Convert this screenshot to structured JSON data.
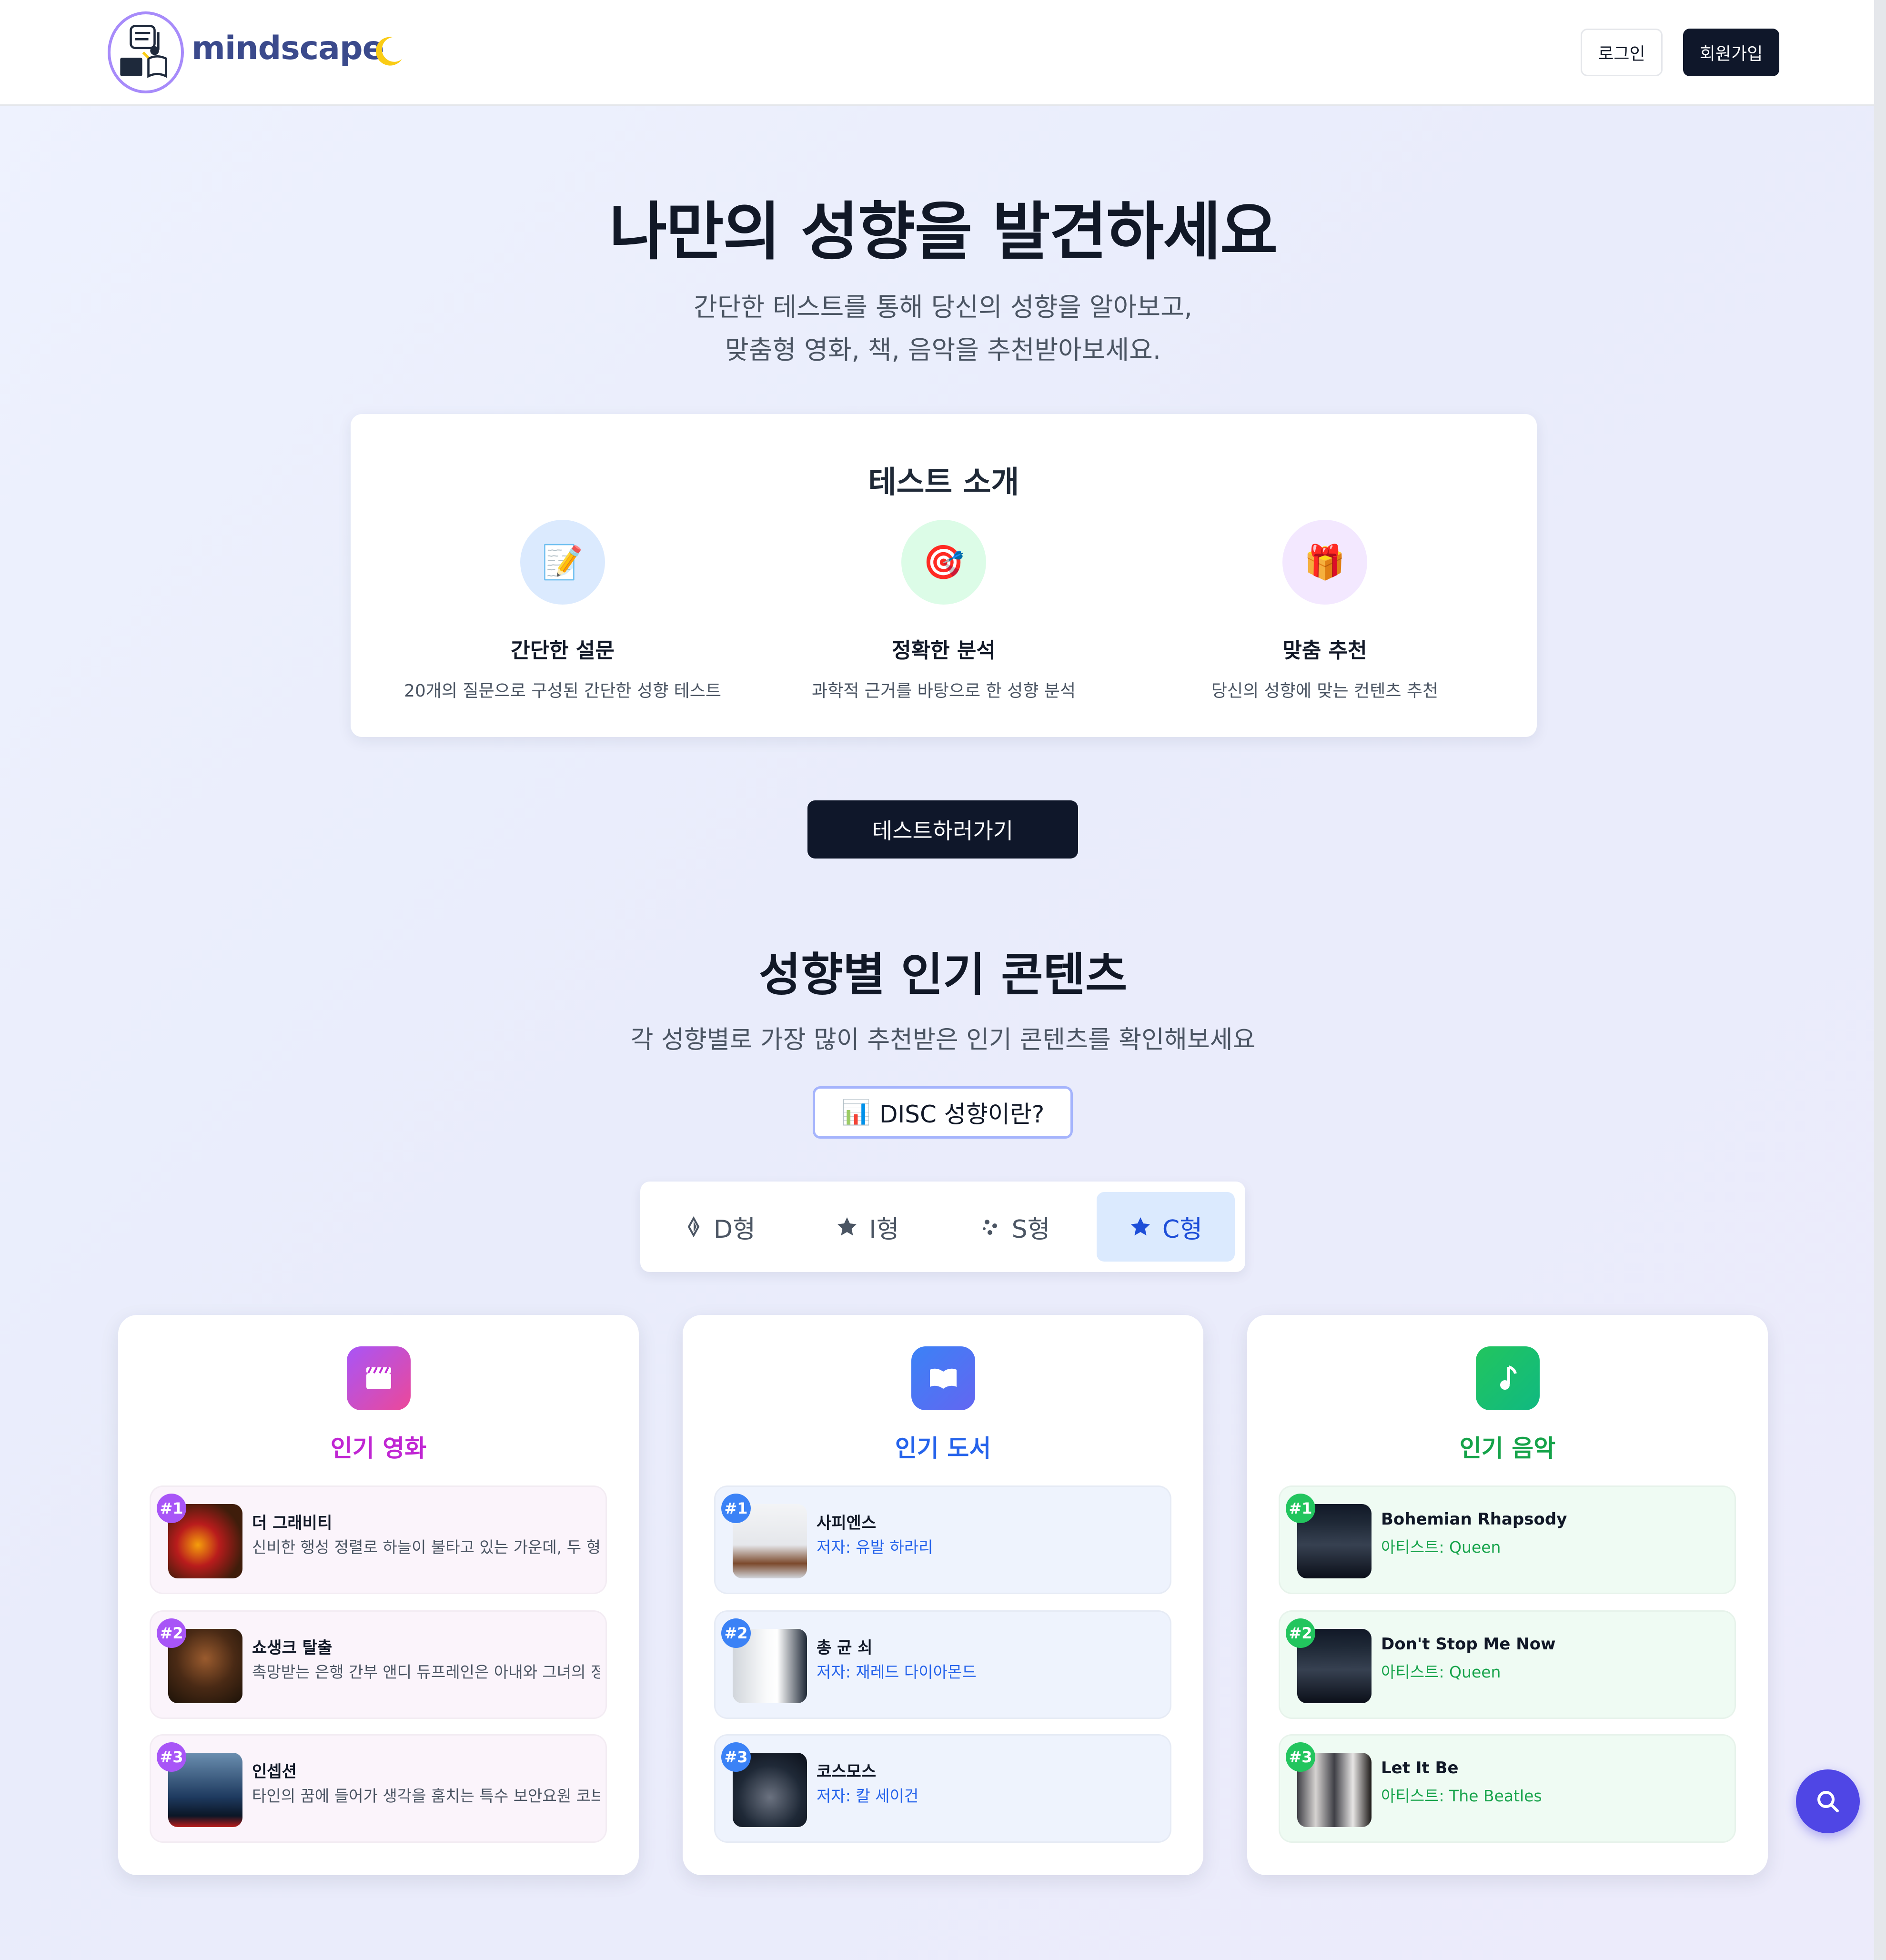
{
  "header": {
    "brand": "mindscape",
    "login_label": "로그인",
    "signup_label": "회원가입"
  },
  "hero": {
    "title": "나만의 성향을 발견하세요",
    "subtitle_line1": "간단한 테스트를 통해 당신의 성향을 알아보고,",
    "subtitle_line2": "맞춤형 영화, 책, 음악을 추천받아보세요."
  },
  "intro": {
    "title": "테스트 소개",
    "features": [
      {
        "icon": "memo-icon",
        "emoji": "📝",
        "title": "간단한 설문",
        "desc": "20개의 질문으로 구성된 간단한 성향 테스트",
        "bg": "#dbeafe"
      },
      {
        "icon": "target-icon",
        "emoji": "🎯",
        "title": "정확한 분석",
        "desc": "과학적 근거를 바탕으로 한 성향 분석",
        "bg": "#dcfce7"
      },
      {
        "icon": "gift-icon",
        "emoji": "🎁",
        "title": "맞춤 추천",
        "desc": "당신의 성향에 맞는 컨텐츠 추천",
        "bg": "#f3e8ff"
      }
    ]
  },
  "cta": {
    "test_label": "테스트하러가기"
  },
  "popular": {
    "title": "성향별 인기 콘텐츠",
    "subtitle": "각 성향별로 가장 많이 추천받은 인기 콘텐츠를 확인해보세요",
    "disc_emoji": "📊",
    "disc_label": "DISC 성향이란?",
    "tabs": [
      {
        "label": "D형",
        "icon": "diamond-icon",
        "active": false
      },
      {
        "label": "I형",
        "icon": "star-icon",
        "active": false
      },
      {
        "label": "S형",
        "icon": "sparkle-icon",
        "active": false
      },
      {
        "label": "C형",
        "icon": "star-icon",
        "active": true
      }
    ]
  },
  "cards": {
    "movies": {
      "title": "인기 영화",
      "color": "#c026d3",
      "items": [
        {
          "rank": "#1",
          "title": "더 그래비티",
          "desc": "신비한 행성 정렬로 하늘이 불타고 있는 가운데, 두 형제"
        },
        {
          "rank": "#2",
          "title": "쇼생크 탈출",
          "desc": "촉망받는 은행 간부 앤디 듀프레인은 아내와 그녀의 정부"
        },
        {
          "rank": "#3",
          "title": "인셉션",
          "desc": "타인의 꿈에 들어가 생각을 훔치는 특수 보안요원 코브."
        }
      ]
    },
    "books": {
      "title": "인기 도서",
      "color": "#2563eb",
      "items": [
        {
          "rank": "#1",
          "title": "사피엔스",
          "desc": "저자: 유발 하라리"
        },
        {
          "rank": "#2",
          "title": "총 균 쇠",
          "desc": "저자: 재레드 다이아몬드"
        },
        {
          "rank": "#3",
          "title": "코스모스",
          "desc": "저자: 칼 세이건"
        }
      ]
    },
    "music": {
      "title": "인기 음악",
      "color": "#16a34a",
      "items": [
        {
          "rank": "#1",
          "title": "Bohemian Rhapsody",
          "desc": "아티스트: Queen"
        },
        {
          "rank": "#2",
          "title": "Don't Stop Me Now",
          "desc": "아티스트: Queen"
        },
        {
          "rank": "#3",
          "title": "Let It Be",
          "desc": "아티스트: The Beatles"
        }
      ]
    }
  }
}
